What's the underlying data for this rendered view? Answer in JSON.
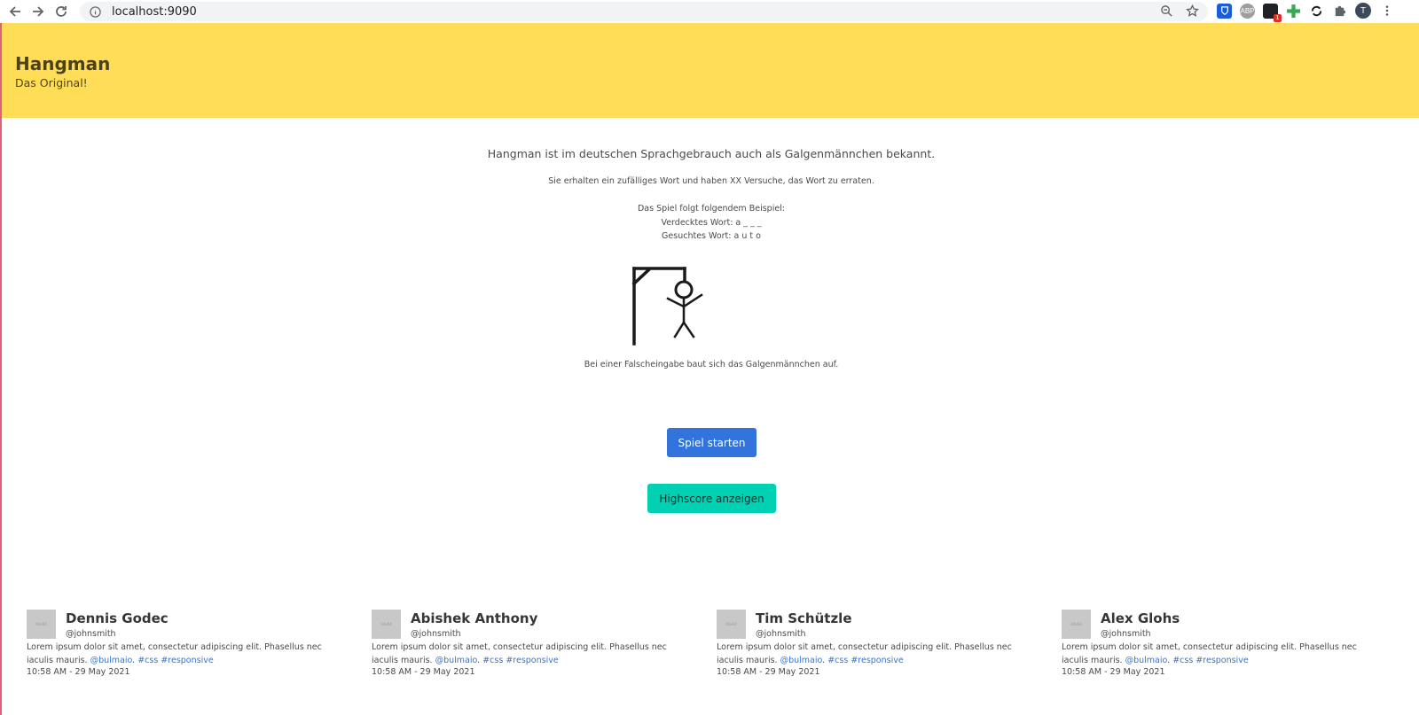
{
  "browser": {
    "url": "localhost:9090",
    "profile_initial": "T",
    "extensions": [
      {
        "name": "bitwarden-icon",
        "color": "#175ddc"
      },
      {
        "name": "adblock-icon",
        "color": "#9e9e9e",
        "label": "ABP"
      },
      {
        "name": "notification-icon",
        "color": "#202124",
        "badge": "1"
      },
      {
        "name": "plus-icon",
        "color": "#34a853"
      },
      {
        "name": "sync-icon",
        "color": "#202124"
      },
      {
        "name": "puzzle-icon",
        "color": "#5f6368"
      }
    ]
  },
  "hero": {
    "title": "Hangman",
    "subtitle": "Das Original!",
    "background": "#ffdd57"
  },
  "main": {
    "intro": "Hangman ist im deutschen Sprachgebrauch auch als Galgenmännchen bekannt.",
    "rule": "Sie erhalten ein zufälliges Wort und haben XX Versuche, das Wort zu erraten.",
    "example_heading": "Das Spiel folgt folgendem Beispiel:",
    "example_hidden": "Verdecktes Wort: a _ _ _",
    "example_solution": "Gesuchtes Wort: a u t o",
    "caption": "Bei einer Falscheingabe baut sich das Galgenmännchen auf."
  },
  "buttons": {
    "start_label": "Spiel starten",
    "start_color": "#3273dc",
    "highscore_label": "Highscore anzeigen",
    "highscore_color": "#00d1b2"
  },
  "team": [
    {
      "name": "Dennis Godec",
      "handle": "@johnsmith",
      "text": "Lorem ipsum dolor sit amet, consectetur adipiscing elit. Phasellus nec iaculis mauris.",
      "mention": "@bulmaio",
      "tags": "#css #responsive",
      "time": "10:58 AM - 29 May 2021"
    },
    {
      "name": "Abishek Anthony",
      "handle": "@johnsmith",
      "text": "Lorem ipsum dolor sit amet, consectetur adipiscing elit. Phasellus nec iaculis mauris.",
      "mention": "@bulmaio",
      "tags": "#css #responsive",
      "time": "10:58 AM - 29 May 2021"
    },
    {
      "name": "Tim Schützle",
      "handle": "@johnsmith",
      "text": "Lorem ipsum dolor sit amet, consectetur adipiscing elit. Phasellus nec iaculis mauris.",
      "mention": "@bulmaio",
      "tags": "#css #responsive",
      "time": "10:58 AM - 29 May 2021"
    },
    {
      "name": "Alex Glohs",
      "handle": "@johnsmith",
      "text": "Lorem ipsum dolor sit amet, consectetur adipiscing elit. Phasellus nec iaculis mauris.",
      "mention": "@bulmaio",
      "tags": "#css #responsive",
      "time": "10:58 AM - 29 May 2021"
    }
  ]
}
